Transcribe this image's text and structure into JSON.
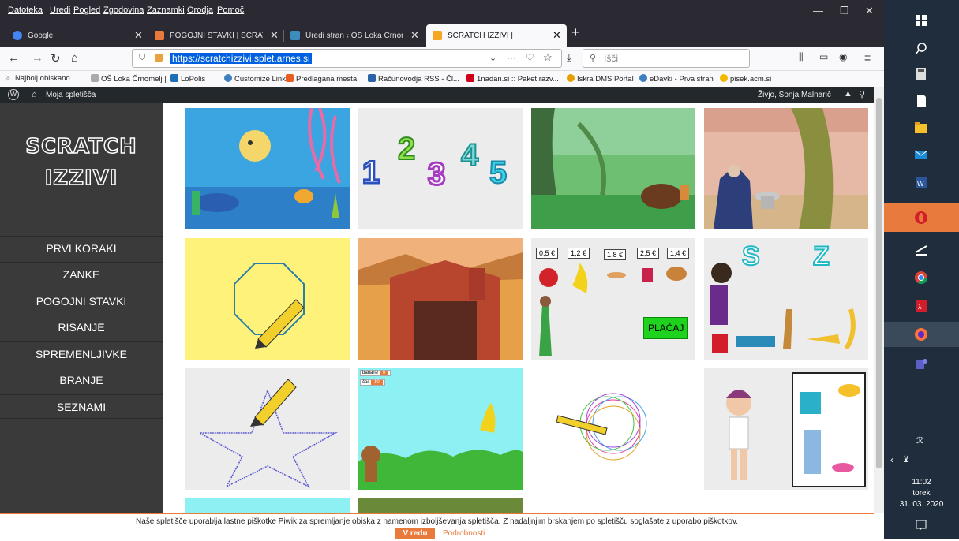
{
  "menu": [
    "Datoteka",
    "Uredi",
    "Pogled",
    "Zgodovina",
    "Zaznamki",
    "Orodja",
    "Pomoč"
  ],
  "tabs": [
    {
      "label": "Google",
      "color": "#4285f4"
    },
    {
      "label": "POGOJNI STAVKI | SCRATCH IZZ",
      "color": "#e87b3c"
    },
    {
      "label": "Uredi stran ‹ OŠ Loka Črnomelj",
      "color": "#3c8dbc"
    },
    {
      "label": "SCRATCH IZZIVI |",
      "color": "#f5a623"
    }
  ],
  "url": "https://scratchizzivi.splet.arnes.si",
  "search_placeholder": "Išči",
  "bookmarks": [
    {
      "label": "Najbolj obiskano",
      "color": "#777"
    },
    {
      "label": "OŠ Loka Črnomelj |",
      "color": "#aaa"
    },
    {
      "label": "LoPolis",
      "color": "#1f6fb5"
    },
    {
      "label": "Customize Links",
      "color": "#3d7fbf"
    },
    {
      "label": "Predlagana mesta",
      "color": "#e85d1f"
    },
    {
      "label": "Računovodja RSS - Čl...",
      "color": "#2a62a8"
    },
    {
      "label": "1nadan.si :: Paket razv...",
      "color": "#d0021b"
    },
    {
      "label": "Iskra DMS Portal",
      "color": "#e5a100"
    },
    {
      "label": "eDavki - Prva stran",
      "color": "#3d7fbf"
    },
    {
      "label": "pisek.acm.si",
      "color": "#f5b800"
    }
  ],
  "wp": {
    "site": "Moja spletišča",
    "greeting": "Živjo, Sonja Malnarič"
  },
  "site": {
    "title_line1": "SCRATCH",
    "title_line2": "IZZIVI"
  },
  "nav": [
    "PRVI KORAKI",
    "ZANKE",
    "POGOJNI STAVKI",
    "RISANJE",
    "SPREMENLJIVKE",
    "BRANJE",
    "SEZNAMI"
  ],
  "tiles": {
    "numbers": [
      "1",
      "2",
      "3",
      "4",
      "5"
    ],
    "prices": [
      "0,5 €",
      "1,2 €",
      "1,8 €",
      "2,5 €",
      "1,4 €"
    ],
    "pay": "PLAČAJ",
    "letters": [
      "S",
      "Z"
    ],
    "banana_label": "banane",
    "time_label": "čas"
  },
  "cookie": {
    "text": "Naše spletišče uporablja lastne piškotke Piwik za spremljanje obiska z namenom izboljševanja spletišča. Z nadaljnjim brskanjem po spletišču soglašate z uporabo piškotkov.",
    "ok": "V redu",
    "more": "Podrobnosti"
  },
  "clock": {
    "time": "11:02",
    "day": "torek",
    "date": "31. 03. 2020"
  },
  "colors": {
    "accent": "#e87b3c",
    "sidebar": "#3a3a3a",
    "taskbar": "#1f2d3d"
  }
}
